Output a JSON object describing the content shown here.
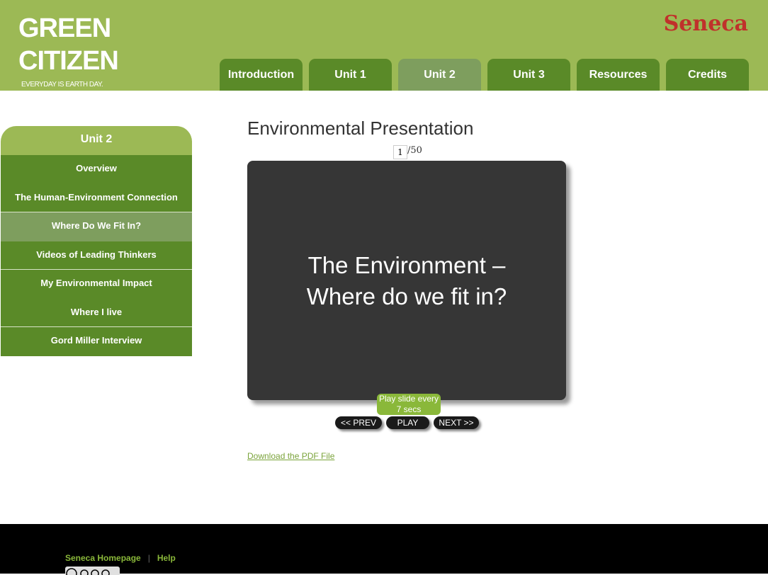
{
  "header": {
    "logo_line1": "GREEN",
    "logo_line2": "CITIZEN",
    "tagline": "EVERYDAY IS EARTH DAY.",
    "brand": "Seneca",
    "colors": {
      "header_bg": "#9cb955",
      "tab_bg": "#5a8a28",
      "tab_active_bg": "#7e9e5e",
      "brand": "#c0312b"
    }
  },
  "nav": {
    "tabs": [
      {
        "label": "Introduction"
      },
      {
        "label": "Unit 1"
      },
      {
        "label": "Unit 2",
        "active": true
      },
      {
        "label": "Unit 3"
      },
      {
        "label": "Resources"
      },
      {
        "label": "Credits"
      }
    ]
  },
  "sidebar": {
    "title": "Unit 2",
    "items": [
      {
        "label": "Overview"
      },
      {
        "label": "The Human-Environment Connection"
      },
      {
        "label": "Where Do We Fit In?",
        "active": true
      },
      {
        "label": "Videos of Leading Thinkers"
      },
      {
        "label": "My Environmental Impact"
      },
      {
        "label": "Where I live"
      },
      {
        "label": "Gord Miller Interview"
      }
    ]
  },
  "main": {
    "title": "Environmental Presentation",
    "slide_current": "1",
    "slide_total": "/50",
    "slide_text_line1": "The Environment –",
    "slide_text_line2": "Where do we fit in?",
    "play_interval_line1": "Play slide every",
    "play_interval_line2": "7 secs",
    "prev_label": "<< PREV",
    "play_label": "PLAY",
    "next_label": "NEXT >>",
    "download_label": "Download the PDF File"
  },
  "footer": {
    "homepage_label": "Seneca Homepage",
    "separator": "|",
    "help_label": "Help",
    "cc_icon": "creative-commons-icon"
  }
}
